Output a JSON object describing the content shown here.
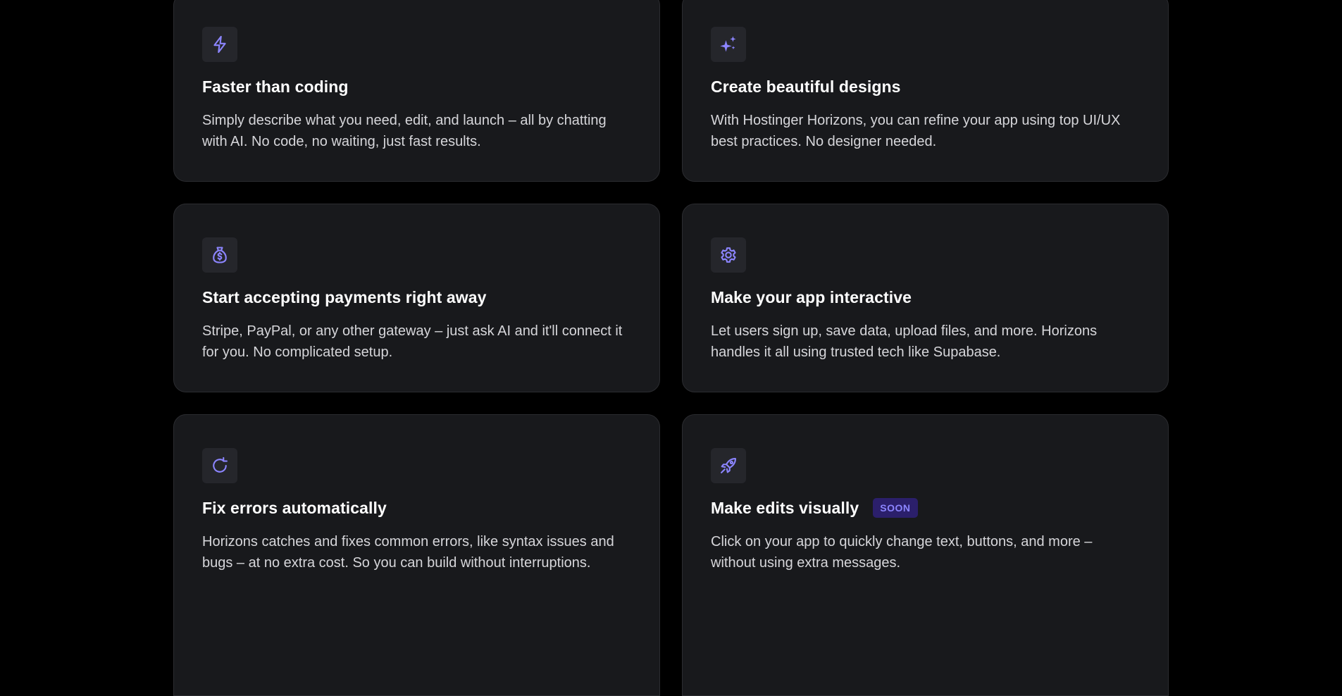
{
  "colors": {
    "page_background": "#000000",
    "card_background": "#18191c",
    "card_border": "#2b2c30",
    "icon_tile": "#25262b",
    "accent": "#8c85ff",
    "badge_background": "#2b1f6b",
    "title": "#ffffff",
    "description": "#d6d6da"
  },
  "features": [
    {
      "icon": "lightning-icon",
      "title": "Faster than coding",
      "description": "Simply describe what you need, edit, and launch – all by chatting with AI. No code, no waiting, just fast results."
    },
    {
      "icon": "sparkles-icon",
      "title": "Create beautiful designs",
      "description": "With Hostinger Horizons, you can refine your app using top UI/UX best practices. No designer needed."
    },
    {
      "icon": "money-bag-icon",
      "title": "Start accepting payments right away",
      "description": "Stripe, PayPal, or any other gateway – just ask AI and it'll connect it for you. No complicated setup."
    },
    {
      "icon": "gear-icon",
      "title": "Make your app interactive",
      "description": "Let users sign up, save data, upload files, and more. Horizons handles it all using trusted tech like Supabase."
    },
    {
      "icon": "refresh-icon",
      "title": "Fix errors automatically",
      "description": "Horizons catches and fixes common errors, like syntax issues and bugs – at no extra cost. So you can build without interruptions."
    },
    {
      "icon": "rocket-icon",
      "title": "Make edits visually",
      "badge": "SOON",
      "description": "Click on your app to quickly change text, buttons, and more – without using extra messages."
    }
  ]
}
